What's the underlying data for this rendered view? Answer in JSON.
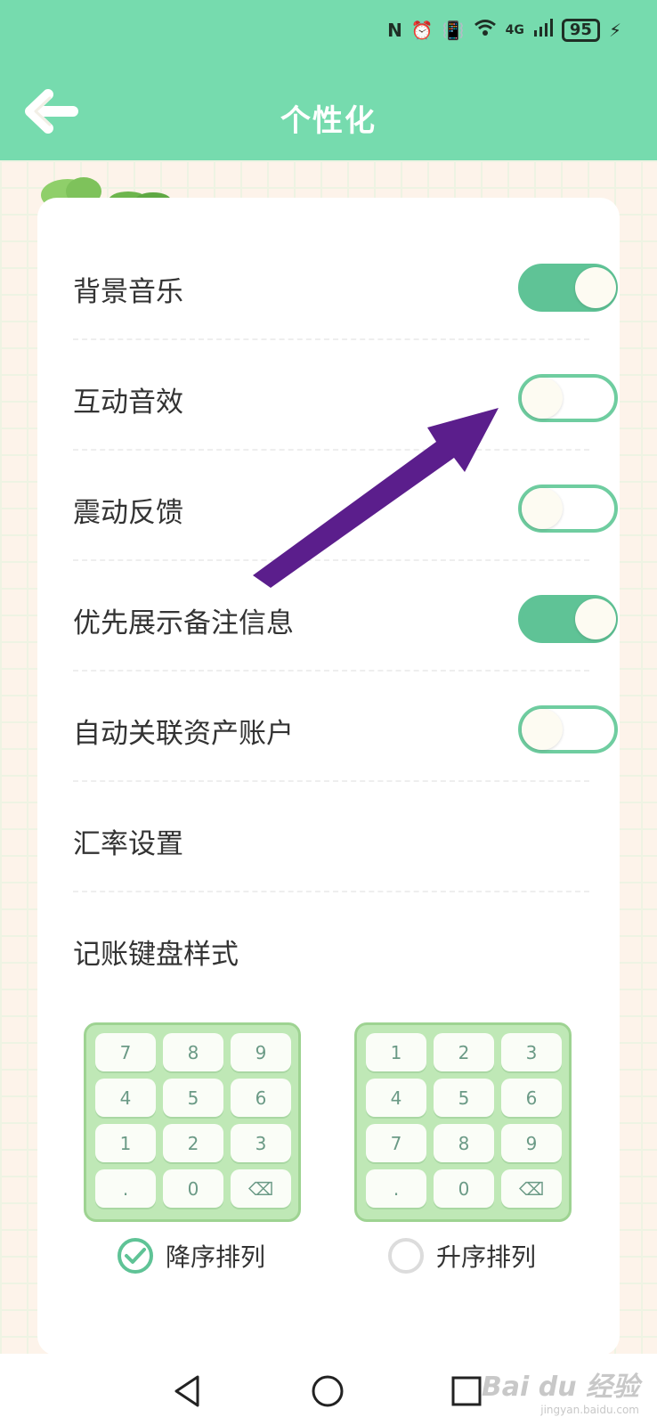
{
  "status_bar": {
    "network": "4G",
    "battery": "95"
  },
  "header": {
    "title": "个性化"
  },
  "settings": [
    {
      "label": "背景音乐",
      "toggle": true
    },
    {
      "label": "互动音效",
      "toggle": false
    },
    {
      "label": "震动反馈",
      "toggle": false
    },
    {
      "label": "优先展示备注信息",
      "toggle": true
    },
    {
      "label": "自动关联资产账户",
      "toggle": false
    },
    {
      "label": "汇率设置"
    },
    {
      "label": "记账键盘样式"
    }
  ],
  "keypads": [
    {
      "keys": [
        "7",
        "8",
        "9",
        "4",
        "5",
        "6",
        "1",
        "2",
        "3",
        ".",
        "0",
        "⌫"
      ],
      "label": "降序排列",
      "selected": true
    },
    {
      "keys": [
        "1",
        "2",
        "3",
        "4",
        "5",
        "6",
        "7",
        "8",
        "9",
        ".",
        "0",
        "⌫"
      ],
      "label": "升序排列",
      "selected": false
    }
  ],
  "watermark": {
    "brand": "Bai du 经验",
    "url": "jingyan.baidu.com"
  },
  "colors": {
    "accent": "#76dbae",
    "toggle_on": "#5fc396",
    "arrow": "#5b1e8c",
    "keypad_bg": "#bfe8b6"
  }
}
